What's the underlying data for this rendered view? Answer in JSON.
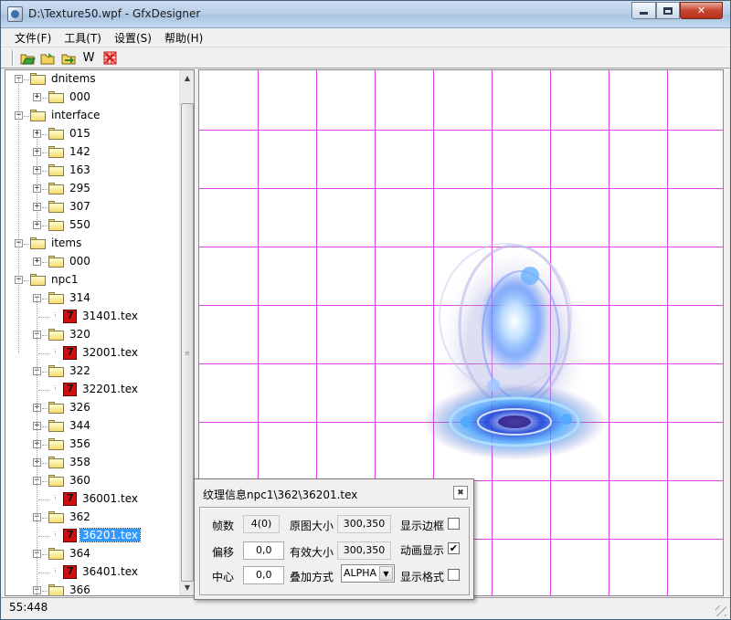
{
  "window": {
    "title": "D:\\Texture50.wpf - GfxDesigner"
  },
  "menu": {
    "items": [
      "文件(F)",
      "工具(T)",
      "设置(S)",
      "帮助(H)"
    ]
  },
  "toolbar": {
    "tools": [
      {
        "name": "open-folder-icon",
        "color": "#2e8b2e"
      },
      {
        "name": "save-folder-icon",
        "color": "#caa200"
      },
      {
        "name": "export-folder-icon",
        "color": "#2e8b2e"
      },
      {
        "name": "w-tool",
        "label": "W"
      },
      {
        "name": "grid-tool-icon",
        "color": "#d01010"
      }
    ]
  },
  "tree": {
    "nodes": [
      {
        "label": "dnitems",
        "level": 0,
        "type": "folder",
        "expanded": true
      },
      {
        "label": "000",
        "level": 1,
        "type": "folder",
        "expanded": false
      },
      {
        "label": "interface",
        "level": 0,
        "type": "folder",
        "expanded": true
      },
      {
        "label": "015",
        "level": 1,
        "type": "folder",
        "expanded": false
      },
      {
        "label": "142",
        "level": 1,
        "type": "folder",
        "expanded": false
      },
      {
        "label": "163",
        "level": 1,
        "type": "folder",
        "expanded": false
      },
      {
        "label": "295",
        "level": 1,
        "type": "folder",
        "expanded": false
      },
      {
        "label": "307",
        "level": 1,
        "type": "folder",
        "expanded": false
      },
      {
        "label": "550",
        "level": 1,
        "type": "folder",
        "expanded": false
      },
      {
        "label": "items",
        "level": 0,
        "type": "folder",
        "expanded": true
      },
      {
        "label": "000",
        "level": 1,
        "type": "folder",
        "expanded": false
      },
      {
        "label": "npc1",
        "level": 0,
        "type": "folder",
        "expanded": true
      },
      {
        "label": "314",
        "level": 1,
        "type": "folder",
        "expanded": true
      },
      {
        "label": "31401.tex",
        "level": 2,
        "type": "file"
      },
      {
        "label": "320",
        "level": 1,
        "type": "folder",
        "expanded": true
      },
      {
        "label": "32001.tex",
        "level": 2,
        "type": "file"
      },
      {
        "label": "322",
        "level": 1,
        "type": "folder",
        "expanded": true
      },
      {
        "label": "32201.tex",
        "level": 2,
        "type": "file"
      },
      {
        "label": "326",
        "level": 1,
        "type": "folder",
        "expanded": false
      },
      {
        "label": "344",
        "level": 1,
        "type": "folder",
        "expanded": false
      },
      {
        "label": "356",
        "level": 1,
        "type": "folder",
        "expanded": false
      },
      {
        "label": "358",
        "level": 1,
        "type": "folder",
        "expanded": false
      },
      {
        "label": "360",
        "level": 1,
        "type": "folder",
        "expanded": true
      },
      {
        "label": "36001.tex",
        "level": 2,
        "type": "file"
      },
      {
        "label": "362",
        "level": 1,
        "type": "folder",
        "expanded": true
      },
      {
        "label": "36201.tex",
        "level": 2,
        "type": "file",
        "selected": true
      },
      {
        "label": "364",
        "level": 1,
        "type": "folder",
        "expanded": true
      },
      {
        "label": "36401.tex",
        "level": 2,
        "type": "file"
      },
      {
        "label": "366",
        "level": 1,
        "type": "folder",
        "expanded": true
      }
    ]
  },
  "canvas": {
    "grid_color": "#e040e0",
    "effect_color": "#4a8cff"
  },
  "texture_info": {
    "title": "纹理信息npc1\\362\\36201.tex",
    "frames_label": "帧数",
    "frames_value": "4(0)",
    "original_size_label": "原图大小",
    "original_size_value": "300,350",
    "show_border_label": "显示边框",
    "show_border_checked": false,
    "offset_label": "偏移",
    "offset_value": "0,0",
    "valid_size_label": "有效大小",
    "valid_size_value": "300,350",
    "animation_label": "动画显示",
    "animation_checked": true,
    "center_label": "中心",
    "center_value": "0,0",
    "blend_label": "叠加方式",
    "blend_value": "ALPHA",
    "show_grid_label": "显示格式",
    "show_grid_checked": false
  },
  "status": {
    "position": "55:448"
  }
}
